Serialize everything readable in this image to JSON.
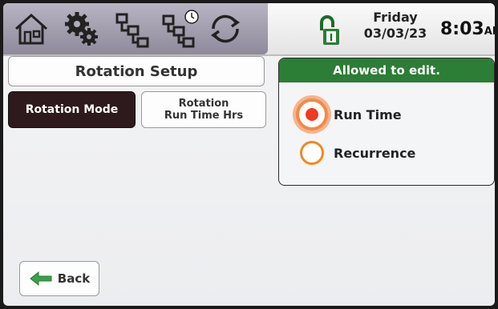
{
  "toolbar": {
    "icons": [
      "home-icon",
      "settings-gears-icon",
      "network-icon",
      "network-schedule-icon",
      "refresh-icon"
    ],
    "lock_icon": "unlocked-icon",
    "day": "Friday",
    "date": "03/03/23",
    "time": "8:03",
    "ampm": "AM"
  },
  "left": {
    "title": "Rotation Setup",
    "tab_active": "Rotation Mode",
    "tab_line1": "Rotation",
    "tab_line2": "Run Time Hrs"
  },
  "edit": {
    "header": "Allowed to edit.",
    "options": [
      {
        "label": "Run Time",
        "selected": true
      },
      {
        "label": "Recurrence",
        "selected": false
      }
    ]
  },
  "back": {
    "label": "Back"
  },
  "colors": {
    "accent_green": "#2c7d35",
    "radio_orange": "#f08a24",
    "radio_dot": "#ef3b1f",
    "active_tab": "#2e1a1c"
  }
}
